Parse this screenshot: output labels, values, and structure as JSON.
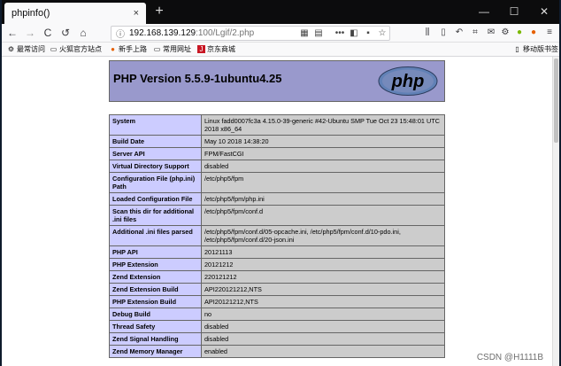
{
  "tab": {
    "title": "phpinfo()",
    "close": "×",
    "new_tab": "+"
  },
  "window": {
    "minimize": "—",
    "maximize": "☐",
    "close": "✕"
  },
  "nav": {
    "back": "←",
    "forward": "→",
    "reload": "C",
    "history": "↺",
    "home": "⌂",
    "url_host": "192.168.139.129",
    "url_path": ":100/Lgif/2.php"
  },
  "bookmarks": [
    {
      "label": "最常访问",
      "icon": "gear-icon"
    },
    {
      "label": "火狐官方站点",
      "icon": "folder-icon"
    },
    {
      "label": "新手上路",
      "icon": "firefox-icon"
    },
    {
      "label": "常用网址",
      "icon": "folder-icon"
    },
    {
      "label": "京东商城",
      "icon": "jd-icon"
    }
  ],
  "mobile_bookmarks": "移动版书签",
  "php": {
    "version_title": "PHP Version 5.5.9-1ubuntu4.25",
    "logo_text": "php"
  },
  "rows": [
    {
      "key": "System",
      "value": "Linux fadd0007fc3a 4.15.0-39-generic #42-Ubuntu SMP Tue Oct 23 15:48:01 UTC 2018 x86_64"
    },
    {
      "key": "Build Date",
      "value": "May 10 2018 14:38:20"
    },
    {
      "key": "Server API",
      "value": "FPM/FastCGI"
    },
    {
      "key": "Virtual Directory Support",
      "value": "disabled"
    },
    {
      "key": "Configuration File (php.ini) Path",
      "value": "/etc/php5/fpm"
    },
    {
      "key": "Loaded Configuration File",
      "value": "/etc/php5/fpm/php.ini"
    },
    {
      "key": "Scan this dir for additional .ini files",
      "value": "/etc/php5/fpm/conf.d"
    },
    {
      "key": "Additional .ini files parsed",
      "value": "/etc/php5/fpm/conf.d/05-opcache.ini, /etc/php5/fpm/conf.d/10-pdo.ini, /etc/php5/fpm/conf.d/20-json.ini"
    },
    {
      "key": "PHP API",
      "value": "20121113"
    },
    {
      "key": "PHP Extension",
      "value": "20121212"
    },
    {
      "key": "Zend Extension",
      "value": "220121212"
    },
    {
      "key": "Zend Extension Build",
      "value": "API220121212,NTS"
    },
    {
      "key": "PHP Extension Build",
      "value": "API20121212,NTS"
    },
    {
      "key": "Debug Build",
      "value": "no"
    },
    {
      "key": "Thread Safety",
      "value": "disabled"
    },
    {
      "key": "Zend Signal Handling",
      "value": "disabled"
    },
    {
      "key": "Zend Memory Manager",
      "value": "enabled"
    }
  ],
  "watermark": "CSDN @H1111B"
}
